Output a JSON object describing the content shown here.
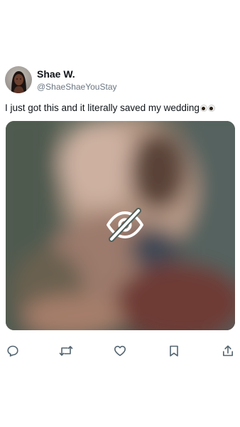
{
  "post": {
    "author_name": "Shae W.",
    "author_handle": "@ShaeShaeYouStay",
    "text": "I just got this and it literally saved my wedding",
    "emoji": "eyes",
    "media_state": "hidden-sensitive"
  },
  "actions": {
    "icons": [
      "reply-icon",
      "repost-icon",
      "like-icon",
      "bookmark-icon",
      "share-icon"
    ],
    "color": "#53646f"
  },
  "colors": {
    "text": "#0f1419",
    "secondary": "#6b7680",
    "background": "#ffffff"
  }
}
